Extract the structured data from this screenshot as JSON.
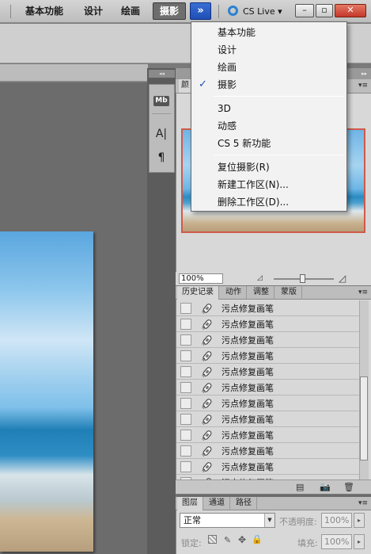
{
  "topbar": {
    "workspaces": [
      "基本功能",
      "设计",
      "绘画"
    ],
    "active_workspace": "摄影",
    "more_button": "»",
    "cs_live": "CS Live ▾",
    "window_controls": {
      "minimize": "–",
      "restore": "▫",
      "close": "✕"
    }
  },
  "workspace_menu": {
    "groups": [
      [
        "基本功能",
        "设计",
        "绘画",
        "摄影"
      ],
      [
        "3D",
        "动感",
        "CS 5 新功能"
      ],
      [
        "复位摄影(R)",
        "新建工作区(N)...",
        "删除工作区(D)..."
      ]
    ],
    "checked_item": "摄影",
    "check_mark": "✓"
  },
  "navigator": {
    "tab_partial": "颜",
    "zoom_value": "100%"
  },
  "history": {
    "tabs": [
      "历史记录",
      "动作",
      "调整",
      "蒙版"
    ],
    "rows": [
      "污点修复画笔",
      "污点修复画笔",
      "污点修复画笔",
      "污点修复画笔",
      "污点修复画笔",
      "污点修复画笔",
      "污点修复画笔",
      "污点修复画笔",
      "污点修复画笔",
      "污点修复画笔",
      "污点修复画笔",
      "污点修复画笔"
    ]
  },
  "layers": {
    "tabs": [
      "图层",
      "通道",
      "路径"
    ],
    "blend_mode": "正常",
    "opacity_label": "不透明度:",
    "opacity_value": "100%",
    "lock_label": "锁定:",
    "fill_label": "填充:",
    "fill_value": "100%"
  },
  "dock": {
    "char_icon": "A|",
    "para_icon": "¶",
    "mb_icon": "Mb"
  }
}
